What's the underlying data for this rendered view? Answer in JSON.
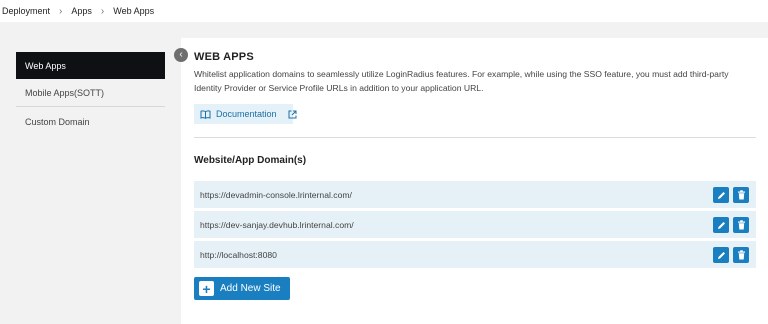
{
  "breadcrumb": {
    "items": [
      "Deployment",
      "Apps",
      "Web Apps"
    ]
  },
  "sidebar": {
    "items": [
      {
        "label": "Web Apps",
        "active": true
      },
      {
        "label": "Mobile Apps(SOTT)",
        "active": false
      },
      {
        "label": "Custom Domain",
        "active": false
      }
    ]
  },
  "main": {
    "title": "WEB APPS",
    "description": "Whitelist application domains to seamlessly utilize LoginRadius features. For example, while using the SSO feature, you must add third-party Identity Provider or Service Profile URLs in addition to your application URL.",
    "documentation_label": "Documentation",
    "section_title": "Website/App Domain(s)",
    "domains": [
      "https://devadmin-console.lrinternal.com/",
      "https://dev-sanjay.devhub.lrinternal.com/",
      "http://localhost:8080"
    ],
    "add_button_label": "Add New Site"
  },
  "icons": {
    "breadcrumb_separator": "chevron-right-icon",
    "collapse": "chevron-left-icon",
    "documentation": "book-icon",
    "external": "external-link-icon",
    "edit": "pencil-icon",
    "delete": "trash-icon",
    "add": "plus-icon"
  },
  "colors": {
    "accent": "#1a7fc0",
    "active_nav": "#0f1014",
    "row_bg": "#e6f1f7",
    "doc_bg": "#e4f1f8"
  }
}
